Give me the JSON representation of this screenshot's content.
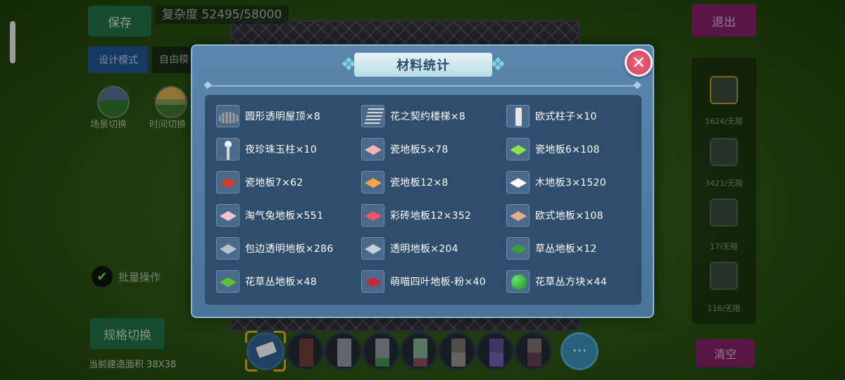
{
  "hud": {
    "save_label": "保存",
    "complexity": "复杂度 52495/58000",
    "design_mode": "设计模式",
    "free_mode": "自由模",
    "scene_switch": "场景切换",
    "time_switch": "时间切换",
    "batch_op": "批量操作",
    "spec_switch": "规格切换",
    "build_area": "当前建造面积 38X38",
    "exit_label": "退出",
    "clear_label": "清空",
    "slots": [
      {
        "count": "1624/无限"
      },
      {
        "count": "3421/无限"
      },
      {
        "count": "17/无限"
      },
      {
        "count": "116/无限"
      }
    ],
    "more_label": "···"
  },
  "modal": {
    "title": "材料统计",
    "close_icon": "close-icon",
    "items": [
      {
        "label": "圆形透明屋顶×8",
        "icon": "dome"
      },
      {
        "label": "花之契约楼梯×8",
        "icon": "stairs"
      },
      {
        "label": "欧式柱子×10",
        "icon": "column"
      },
      {
        "label": "夜珍珠玉柱×10",
        "icon": "pearl-pillar"
      },
      {
        "label": "瓷地板5×78",
        "icon": "tile",
        "color": "#f2b5b5"
      },
      {
        "label": "瓷地板6×108",
        "icon": "tile",
        "color": "#8fe04a"
      },
      {
        "label": "瓷地板7×62",
        "icon": "tile",
        "color": "#d43c32"
      },
      {
        "label": "瓷地板12×8",
        "icon": "tile",
        "color": "#f2a64a"
      },
      {
        "label": "木地板3×1520",
        "icon": "tile",
        "color": "#ffffff"
      },
      {
        "label": "淘气兔地板×551",
        "icon": "tile",
        "color": "#f7c3cf"
      },
      {
        "label": "彩砖地板12×352",
        "icon": "tile",
        "color": "#f0566a"
      },
      {
        "label": "欧式地板×108",
        "icon": "tile",
        "color": "#e0b08a"
      },
      {
        "label": "包边透明地板×286",
        "icon": "tile",
        "color": "#b8c0c8"
      },
      {
        "label": "透明地板×204",
        "icon": "tile",
        "color": "#c9d0d6"
      },
      {
        "label": "草丛地板×12",
        "icon": "tile",
        "color": "#3f9e3a"
      },
      {
        "label": "花草丛地板×48",
        "icon": "tile",
        "color": "#5cbf3a"
      },
      {
        "label": "萌喵四叶地板-粉×40",
        "icon": "tile",
        "color": "#c8283c"
      },
      {
        "label": "花草丛方块×44",
        "icon": "bush"
      }
    ]
  }
}
